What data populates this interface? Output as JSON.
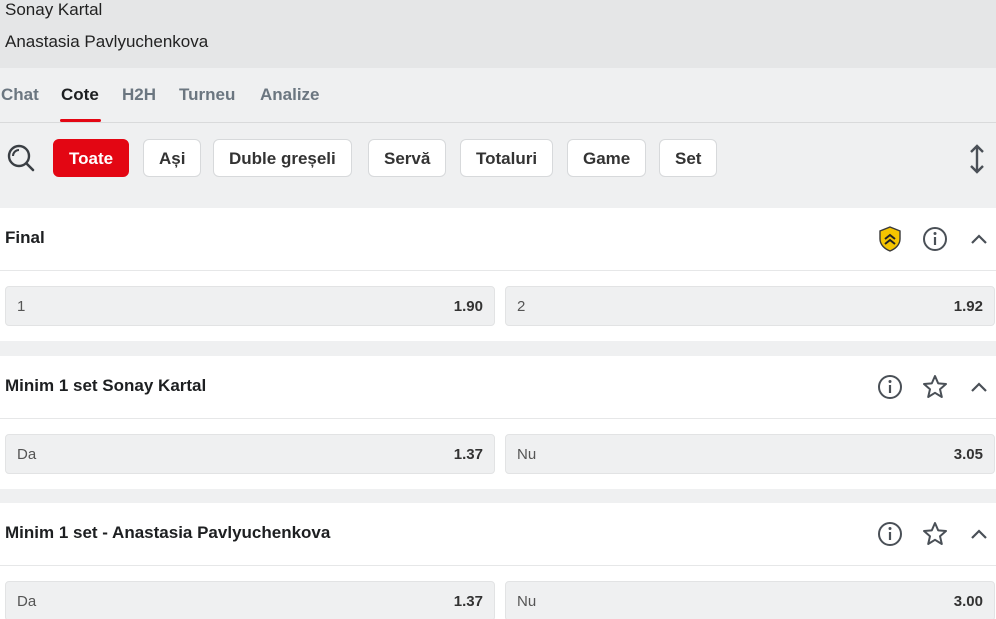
{
  "match": {
    "player1": "Sonay Kartal",
    "player2": "Anastasia Pavlyuchenkova"
  },
  "tabs": [
    {
      "label": "Chat",
      "active": false
    },
    {
      "label": "Cote",
      "active": true
    },
    {
      "label": "H2H",
      "active": false
    },
    {
      "label": "Turneu",
      "active": false
    },
    {
      "label": "Analize",
      "active": false
    }
  ],
  "filters": [
    {
      "label": "Toate",
      "active": true
    },
    {
      "label": "Ași",
      "active": false
    },
    {
      "label": "Duble greșeli",
      "active": false
    },
    {
      "label": "Servă",
      "active": false
    },
    {
      "label": "Totaluri",
      "active": false
    },
    {
      "label": "Game",
      "active": false
    },
    {
      "label": "Set",
      "active": false
    }
  ],
  "colors": {
    "accent": "#e30613",
    "shield": "#f5c400"
  },
  "markets": [
    {
      "title": "Final",
      "icons": [
        "shield-boost-icon",
        "info-icon",
        "chevron-up-icon"
      ],
      "odds": [
        {
          "label": "1",
          "value": "1.90"
        },
        {
          "label": "2",
          "value": "1.92"
        }
      ]
    },
    {
      "title": "Minim 1 set Sonay Kartal",
      "icons": [
        "info-icon",
        "star-icon",
        "chevron-up-icon"
      ],
      "odds": [
        {
          "label": "Da",
          "value": "1.37"
        },
        {
          "label": "Nu",
          "value": "3.05"
        }
      ]
    },
    {
      "title": "Minim 1 set - Anastasia Pavlyuchenkova",
      "icons": [
        "info-icon",
        "star-icon",
        "chevron-up-icon"
      ],
      "odds": [
        {
          "label": "Da",
          "value": "1.37"
        },
        {
          "label": "Nu",
          "value": "3.00"
        }
      ]
    }
  ]
}
